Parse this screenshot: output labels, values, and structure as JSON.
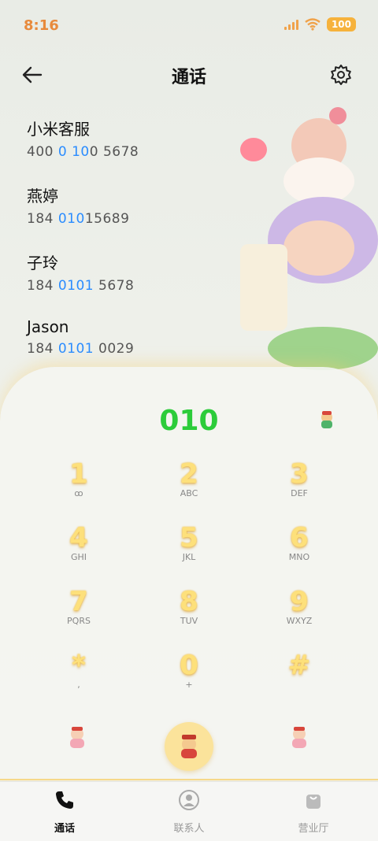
{
  "status": {
    "time": "8:16",
    "battery": "100"
  },
  "header": {
    "title": "通话"
  },
  "contacts": [
    {
      "name": "小米客服",
      "num_pre": "400 ",
      "num_hl": "0 10",
      "num_post": "0 5678"
    },
    {
      "name": "燕婷",
      "num_pre": "184 ",
      "num_hl": "010",
      "num_post": "15689"
    },
    {
      "name": "子玲",
      "num_pre": "184 ",
      "num_hl": "0101",
      "num_post": " 5678"
    },
    {
      "name": "Jason",
      "num_pre": "184 ",
      "num_hl": "0101",
      "num_post": " 0029"
    }
  ],
  "dial": {
    "number": "010"
  },
  "keys": [
    {
      "digit": "1",
      "letters": "ꝏ"
    },
    {
      "digit": "2",
      "letters": "ABC"
    },
    {
      "digit": "3",
      "letters": "DEF"
    },
    {
      "digit": "4",
      "letters": "GHI"
    },
    {
      "digit": "5",
      "letters": "JKL"
    },
    {
      "digit": "6",
      "letters": "MNO"
    },
    {
      "digit": "7",
      "letters": "PQRS"
    },
    {
      "digit": "8",
      "letters": "TUV"
    },
    {
      "digit": "9",
      "letters": "WXYZ"
    },
    {
      "digit": "*",
      "letters": ","
    },
    {
      "digit": "0",
      "letters": "+"
    },
    {
      "digit": "#",
      "letters": ""
    }
  ],
  "nav": [
    {
      "label": "通话",
      "icon": "phone-icon"
    },
    {
      "label": "联系人",
      "icon": "contacts-icon"
    },
    {
      "label": "营业厅",
      "icon": "shopping-bag-icon"
    }
  ],
  "colors": {
    "accent_green": "#2ccc3a",
    "highlight_blue": "#2a8cff",
    "key_gold": "#fde07b",
    "time_orange": "#e88a3c"
  }
}
